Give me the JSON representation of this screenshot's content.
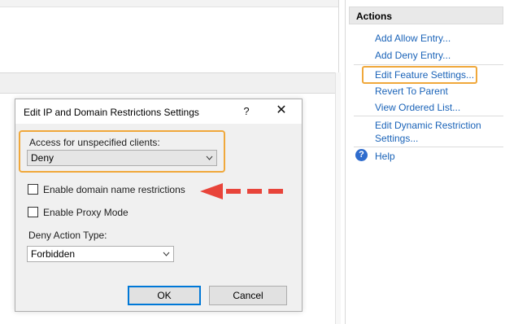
{
  "dialog": {
    "title": "Edit IP and Domain Restrictions Settings",
    "help_glyph": "?",
    "close_glyph": "✕",
    "access_label": "Access for unspecified clients:",
    "access_value": "Deny",
    "enable_domain_label": "Enable domain name restrictions",
    "enable_proxy_label": "Enable Proxy Mode",
    "deny_action_label": "Deny Action Type:",
    "deny_action_value": "Forbidden",
    "ok_label": "OK",
    "cancel_label": "Cancel"
  },
  "actions": {
    "title": "Actions",
    "items": [
      {
        "label": "Add Allow Entry..."
      },
      {
        "label": "Add Deny Entry..."
      },
      {
        "label": "Edit Feature Settings..."
      },
      {
        "label": "Revert To Parent"
      },
      {
        "label": "View Ordered List..."
      },
      {
        "label": "Edit Dynamic Restriction"
      },
      {
        "label": "Settings..."
      },
      {
        "label": "Help"
      }
    ],
    "help_icon_glyph": "?"
  },
  "colors": {
    "highlight": "#f0a83b",
    "link": "#1a63b8",
    "annotation_arrow": "#e8443a"
  },
  "icons": [
    "chevron-down-icon",
    "close-icon",
    "help-icon",
    "annotation-arrow-icon"
  ]
}
